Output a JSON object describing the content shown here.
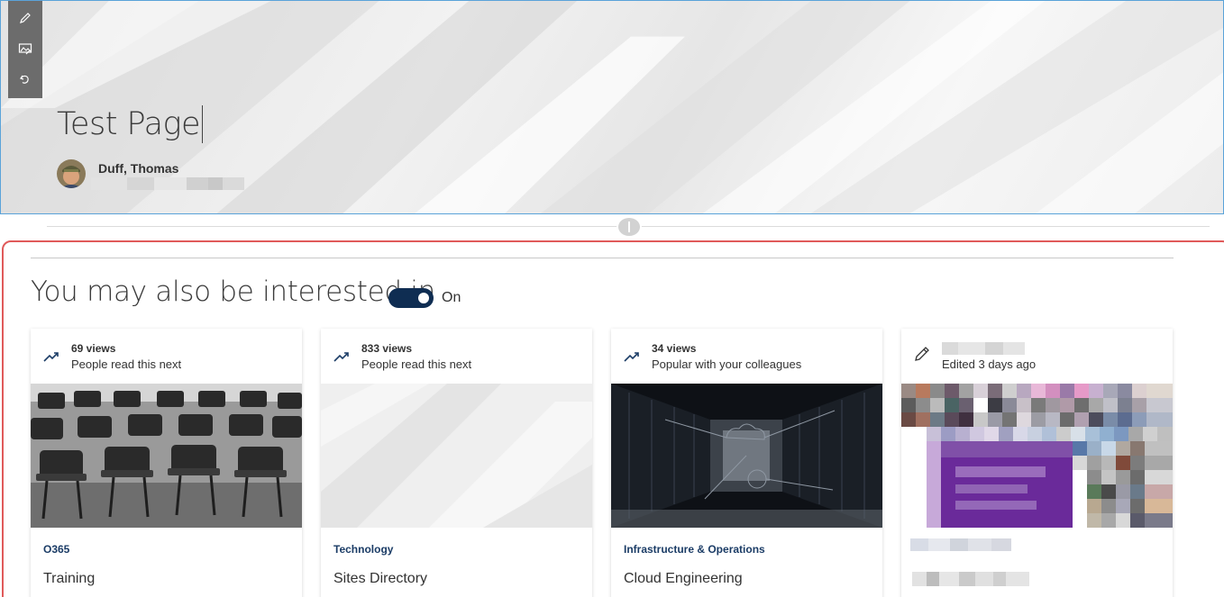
{
  "header": {
    "title": "Test Page",
    "author_name": "Duff, Thomas"
  },
  "toolbar": {
    "edit_icon": "pencil-icon",
    "image_icon": "image-edit-icon",
    "reset_icon": "undo-icon"
  },
  "section": {
    "title": "You may also be interested in",
    "toggle_state": "On",
    "accent_color": "#0f2d52",
    "selection_border_color": "#e05a5a"
  },
  "cards": [
    {
      "views": "69 views",
      "reason": "People read this next",
      "category": "O365",
      "title": "Training",
      "icon": "trending-icon"
    },
    {
      "views": "833 views",
      "reason": "People read this next",
      "category": "Technology",
      "title": "Sites Directory",
      "icon": "trending-icon"
    },
    {
      "views": "34 views",
      "reason": "Popular with your colleagues",
      "category": "Infrastructure & Operations",
      "title": "Cloud Engineering",
      "icon": "trending-icon"
    },
    {
      "views": "",
      "reason": "Edited 3 days ago",
      "category": "",
      "title": "",
      "icon": "pencil-icon"
    }
  ]
}
